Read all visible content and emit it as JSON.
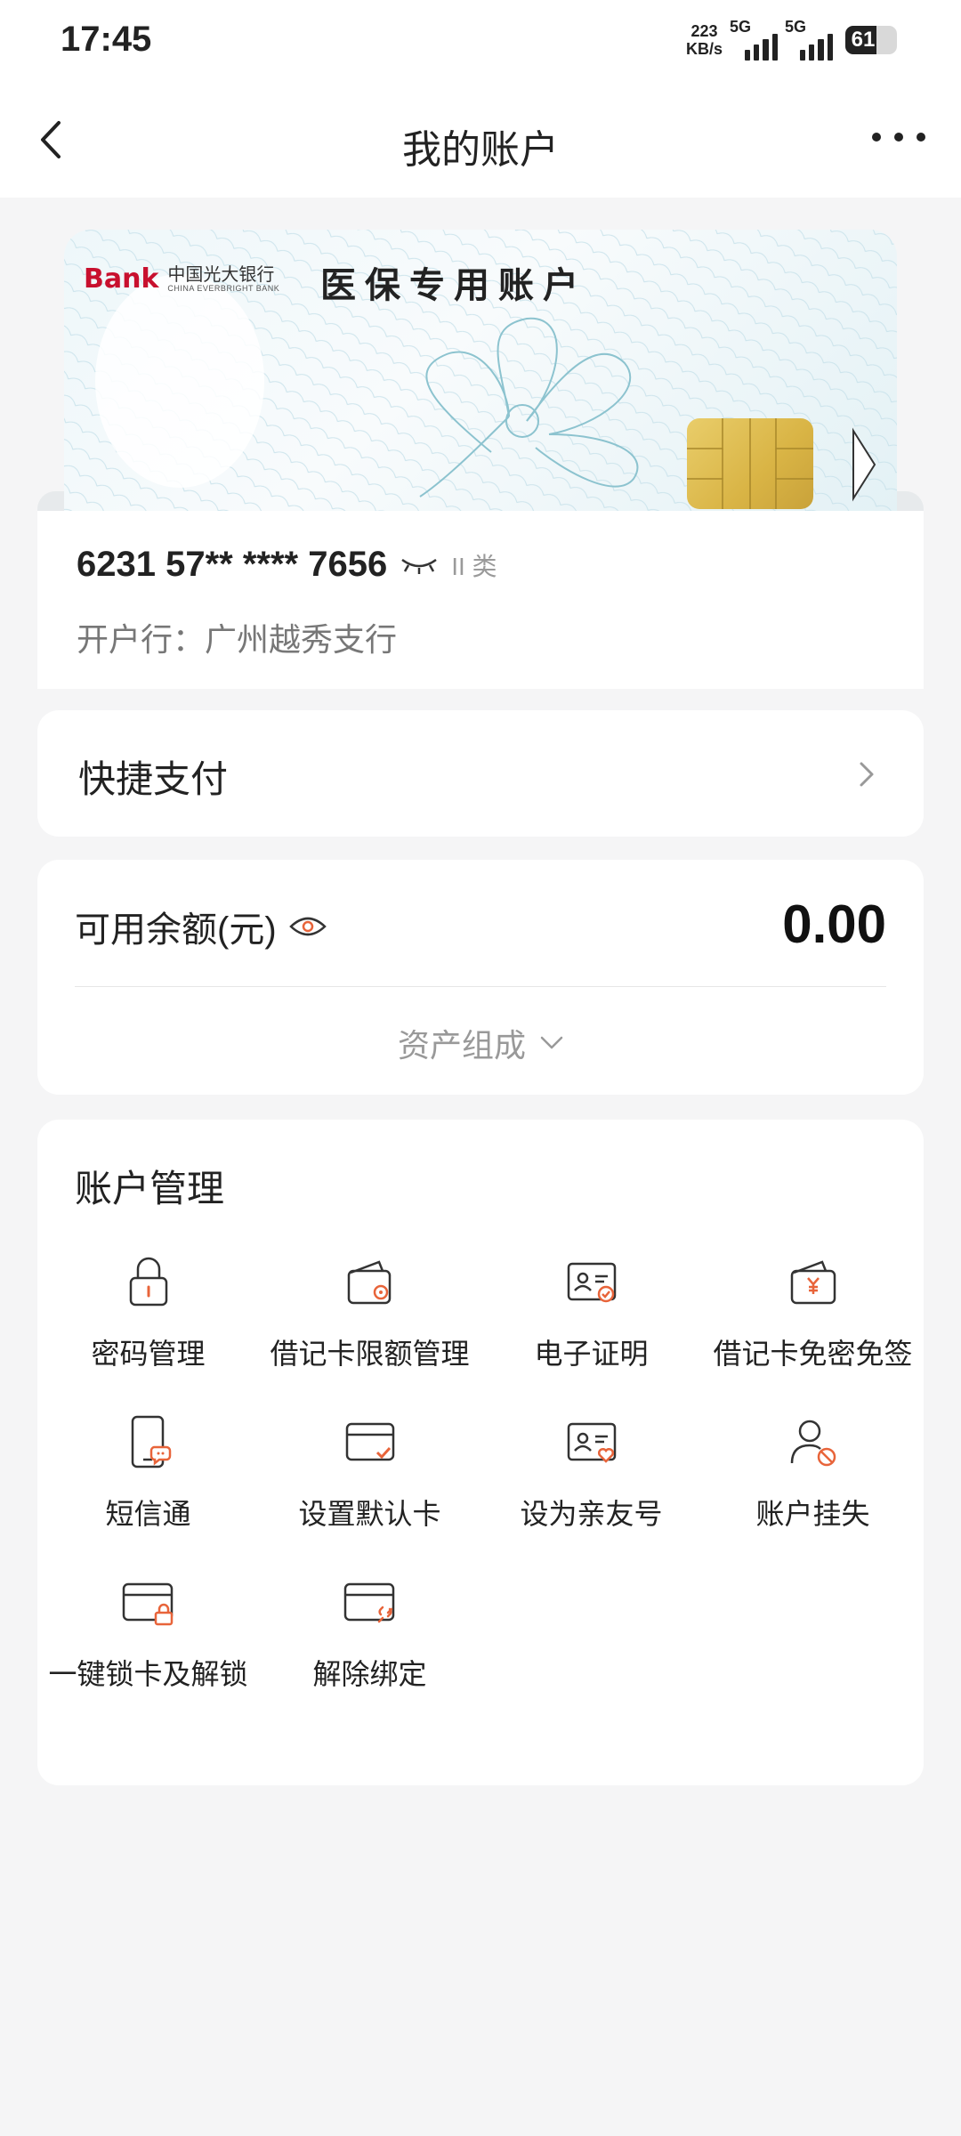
{
  "status_bar": {
    "time": "17:45",
    "net_speed_value": "223",
    "net_speed_unit": "KB/s",
    "signal1_label": "5G",
    "signal2_label": "5G",
    "battery": "61"
  },
  "nav": {
    "title": "我的账户",
    "back_icon": "chevron-left-icon",
    "more_icon": "more-dots-icon"
  },
  "card": {
    "bank_logo_text": "Bank",
    "bank_name_cn": "中国光大银行",
    "bank_name_en": "CHINA EVERBRIGHT BANK",
    "title": "医保专用账户",
    "number": "6231 57** **** 7656",
    "class": "II 类",
    "branch": "开户行：广州越秀支行"
  },
  "quick_pay": {
    "label": "快捷支付"
  },
  "balance": {
    "label": "可用余额(元)",
    "amount": "0.00",
    "asset_label": "资产组成"
  },
  "account_management": {
    "title": "账户管理",
    "items": [
      {
        "label": "密码管理",
        "icon": "lock-icon"
      },
      {
        "label": "借记卡限额管理",
        "icon": "wallet-limit-icon"
      },
      {
        "label": "电子证明",
        "icon": "id-card-check-icon"
      },
      {
        "label": "借记卡免密免签",
        "icon": "wallet-yuan-icon"
      },
      {
        "label": "短信通",
        "icon": "phone-message-icon"
      },
      {
        "label": "设置默认卡",
        "icon": "card-check-icon"
      },
      {
        "label": "设为亲友号",
        "icon": "id-card-heart-icon"
      },
      {
        "label": "账户挂失",
        "icon": "user-block-icon"
      },
      {
        "label": "一键锁卡及解锁",
        "icon": "card-lock-icon"
      },
      {
        "label": "解除绑定",
        "icon": "card-unlink-icon"
      }
    ]
  },
  "colors": {
    "accent": "#e8643a",
    "background": "#f5f5f6"
  }
}
